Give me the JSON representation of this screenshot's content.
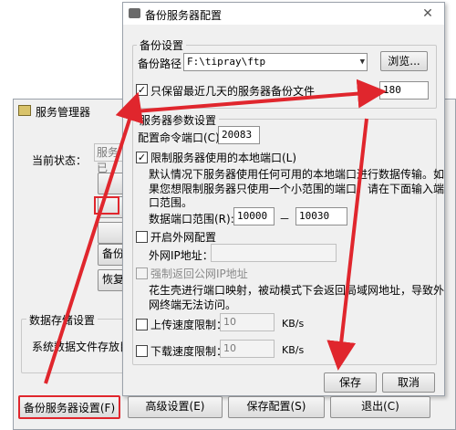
{
  "bg_window": {
    "title": "服务管理器",
    "status_label": "当前状态：",
    "status_value": "服务已",
    "button_partial": "备份",
    "restore_partial": "恢复",
    "data_storage_group": "数据存储设置",
    "data_storage_text": "系统数据文件存放目录"
  },
  "dialog": {
    "title": "备份服务器配置",
    "backup_group": "备份设置",
    "path_label": "备份路径：",
    "path_value": "F:\\tipray\\ftp",
    "browse_button": "浏览...",
    "keep_days_label": "只保留最近几天的服务器备份文件",
    "keep_days_value": "180",
    "server_group": "服务器参数设置",
    "cmd_port_label": "配置命令端口(C):",
    "cmd_port_value": "20083",
    "limit_local_ports_label": "限制服务器使用的本地端口(L)",
    "limit_desc_lines": [
      "默认情况下服务器使用任何可用的本地端口进行数据传输。如",
      "果您想限制服务器只使用一个小范围的端口，请在下面输入端",
      "口范围。"
    ],
    "port_range_label": "数据端口范围(R):",
    "port_range_from": "10000",
    "port_range_dash": "－",
    "port_range_to": "10030",
    "enable_external_label": "开启外网配置",
    "external_ip_label": "外网IP地址：",
    "force_public_ip_label": "强制返回公网IP地址",
    "nat_desc_lines": [
      "花生壳进行端口映射，被动模式下会返回局域网地址，导致外",
      "网终端无法访问。"
    ],
    "upload_limit_label": "上传速度限制：",
    "upload_limit_value": "10",
    "upload_unit": "KB/s",
    "download_limit_label": "下载速度限制：",
    "download_limit_value": "10",
    "download_unit": "KB/s",
    "save_button": "保存",
    "cancel_button": "取消"
  },
  "bottom_bar": {
    "backup_config_button": "备份服务器设置(F)",
    "advanced_button": "高级设置(E)",
    "save_config_button": "保存配置(S)",
    "exit_button": "退出(C)"
  },
  "colors": {
    "annotation_red": "#e0262d",
    "dialog_bg": "#f0f0f0"
  }
}
